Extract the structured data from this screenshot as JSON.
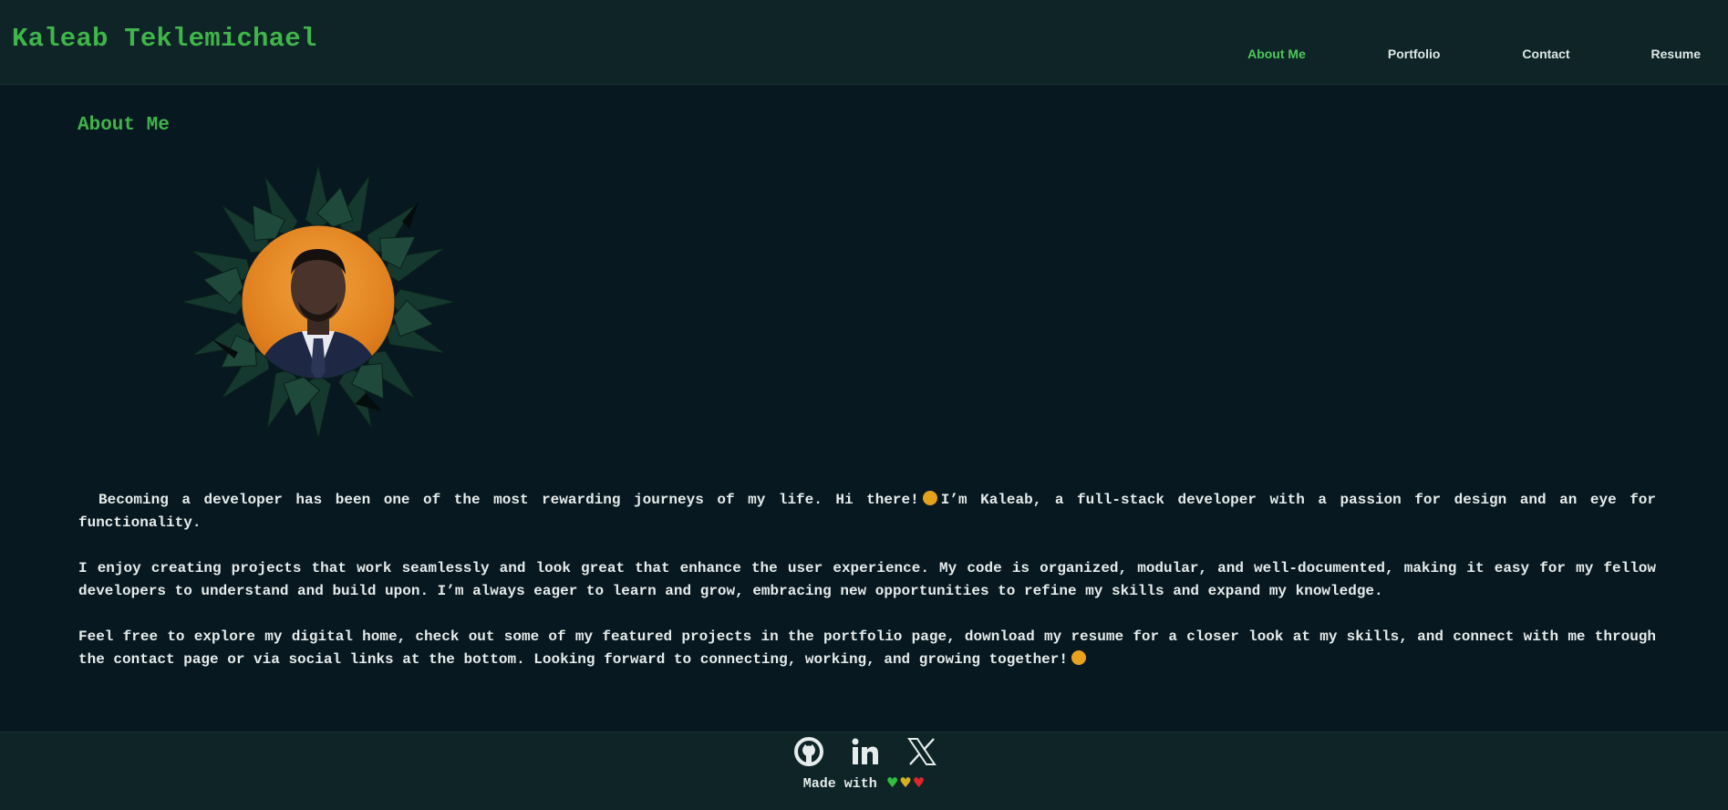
{
  "header": {
    "brand": "Kaleab Teklemichael",
    "nav": [
      {
        "label": "About Me",
        "active": true
      },
      {
        "label": "Portfolio",
        "active": false
      },
      {
        "label": "Contact",
        "active": false
      },
      {
        "label": "Resume",
        "active": false
      }
    ]
  },
  "main": {
    "title": "About Me",
    "portrait_alt": "profile-photo",
    "bio": {
      "p1_a": "Becoming a developer has been one of the most rewarding journeys of my life. Hi there!",
      "p1_b": "I’m Kaleab, a full-stack developer with a passion for design and an eye for functionality.",
      "p2": "I enjoy creating projects that work seamlessly and look great that enhance the user experience. My code is organized, modular, and well-documented, making it easy for my fellow developers to understand and build upon. I’m always eager to learn and grow, embracing new opportunities to refine my skills and expand my knowledge.",
      "p3": "Feel free to explore my digital home, check out some of my featured projects in the portfolio page, download my resume for a closer look at my skills, and connect with me through the contact page or via social links at the bottom. Looking forward to connecting, working, and growing together!"
    }
  },
  "footer": {
    "social": [
      "github-icon",
      "linkedin-icon",
      "x-icon"
    ],
    "made_with": "Made with",
    "hearts": [
      "green",
      "yellow",
      "red"
    ]
  },
  "colors": {
    "accent": "#3fb54a",
    "background": "#071820",
    "header_bg": "#0e2426",
    "text": "#e6ecec"
  }
}
